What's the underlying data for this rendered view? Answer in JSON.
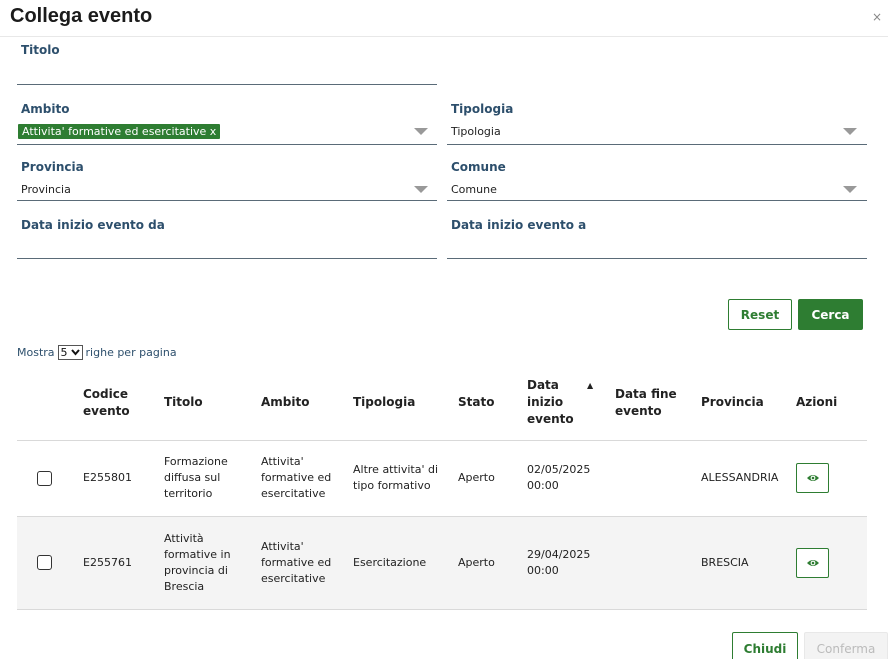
{
  "dialog": {
    "title": "Collega evento",
    "close": "×"
  },
  "form": {
    "titolo": {
      "label": "Titolo",
      "value": ""
    },
    "ambito": {
      "label": "Ambito",
      "chip": "Attivita' formative ed esercitative x"
    },
    "tipologia": {
      "label": "Tipologia",
      "value": "Tipologia"
    },
    "provincia": {
      "label": "Provincia",
      "value": "Provincia"
    },
    "comune": {
      "label": "Comune",
      "value": "Comune"
    },
    "data_da": {
      "label": "Data inizio evento da",
      "value": ""
    },
    "data_a": {
      "label": "Data inizio evento a",
      "value": ""
    }
  },
  "buttons": {
    "reset": "Reset",
    "cerca": "Cerca",
    "chiudi": "Chiudi",
    "conferma": "Conferma"
  },
  "pagination": {
    "prefix": "Mostra",
    "value": "5",
    "suffix": "righe per pagina"
  },
  "table": {
    "headers": {
      "codice": "Codice evento",
      "titolo": "Titolo",
      "ambito": "Ambito",
      "tipologia": "Tipologia",
      "stato": "Stato",
      "data_inizio": "Data inizio evento",
      "data_fine": "Data fine evento",
      "provincia": "Provincia",
      "azioni": "Azioni"
    },
    "sort_indicator": "▲",
    "rows": [
      {
        "codice": "E255801",
        "titolo": "Formazione diffusa sul territorio",
        "ambito": "Attivita' formative ed esercitative",
        "tipologia": "Altre attivita' di tipo formativo",
        "stato": "Aperto",
        "data_inizio": "02/05/2025 00:00",
        "data_fine": "",
        "provincia": "ALESSANDRIA"
      },
      {
        "codice": "E255761",
        "titolo": "Attività formative in provincia di Brescia",
        "ambito": "Attivita' formative ed esercitative",
        "tipologia": "Esercitazione",
        "stato": "Aperto",
        "data_inizio": "29/04/2025 00:00",
        "data_fine": "",
        "provincia": "BRESCIA"
      }
    ]
  },
  "colors": {
    "accent": "#2e7d32",
    "label": "#2d4f6c"
  }
}
